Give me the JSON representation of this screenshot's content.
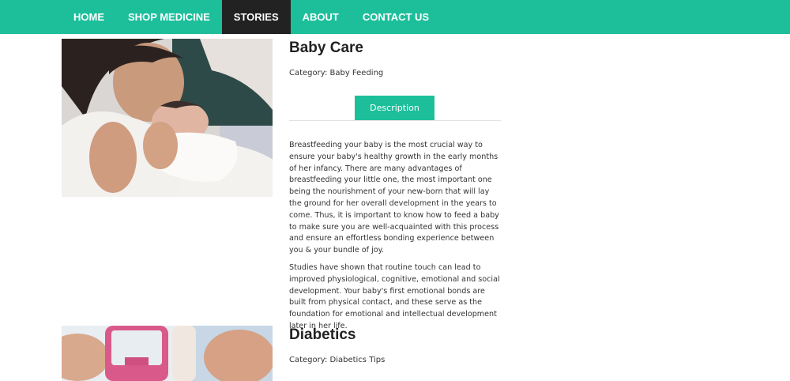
{
  "nav": {
    "items": [
      {
        "label": "HOME",
        "active": false
      },
      {
        "label": "SHOP MEDICINE",
        "active": false
      },
      {
        "label": "STORIES",
        "active": true
      },
      {
        "label": "ABOUT",
        "active": false
      },
      {
        "label": "CONTACT US",
        "active": false
      }
    ]
  },
  "stories": [
    {
      "title": "Baby Care",
      "category": "Category: Baby Feeding",
      "tab_label": "Description",
      "paragraphs": [
        "Breastfeeding your baby is the most crucial way to ensure your baby's healthy growth in the early months of her infancy. There are many advantages of breastfeeding your little one, the most important one being the nourishment of your new-born that will lay the ground for her overall development in the years to come. Thus, it is important to know how to feed a baby to make sure you are well-acquainted with this process and ensure an effortless bonding experience between you & your bundle of joy.",
        "Studies have shown that routine touch can lead to improved physiological, cognitive, emotional and social development. Your baby's first emotional bonds are built from physical contact, and these serve as the foundation for emotional and intellectual development later in her life."
      ]
    },
    {
      "title": "Diabetics",
      "category": "Category: Diabetics Tips"
    }
  ],
  "colors": {
    "accent": "#1dbf9b",
    "nav_active": "#222222"
  }
}
